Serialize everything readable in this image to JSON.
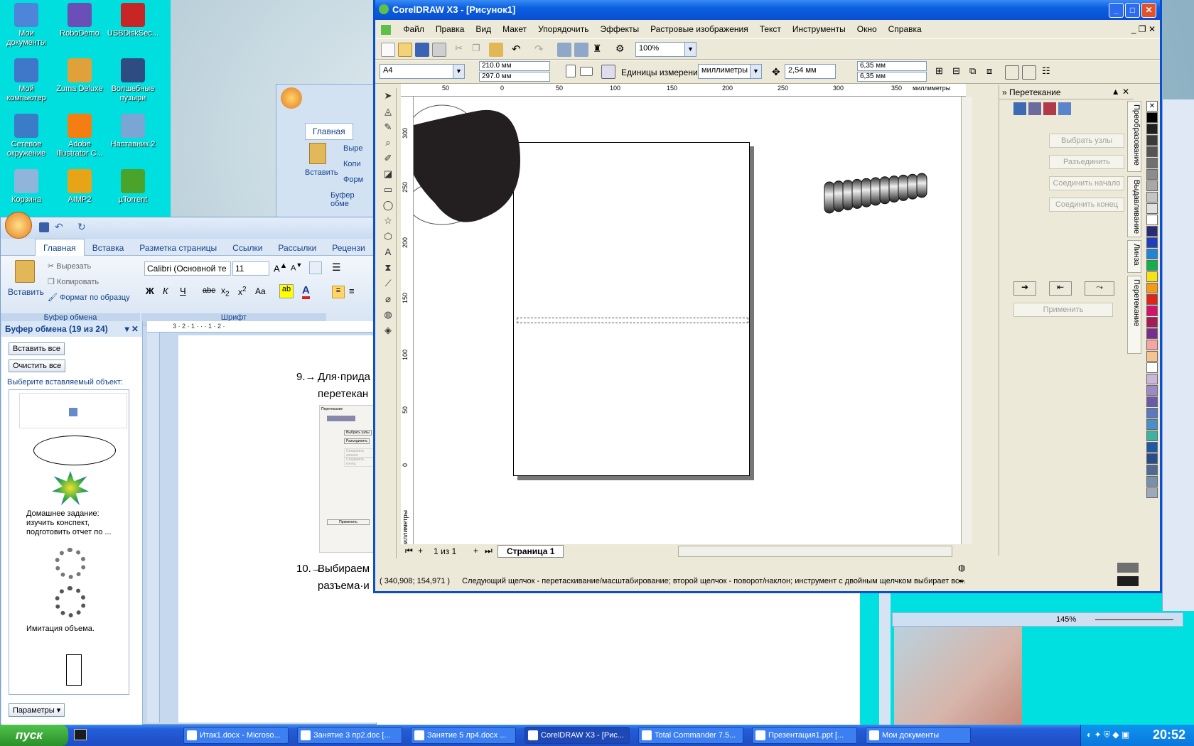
{
  "desktop": {
    "icons": [
      {
        "label": "Мои документы",
        "color": "#4d86d9"
      },
      {
        "label": "RoboDemo",
        "color": "#6a4fb6"
      },
      {
        "label": "USBDiskSec...",
        "color": "#c82626"
      },
      {
        "label": "Мой компьютер",
        "color": "#3f78c9"
      },
      {
        "label": "Zuma Deluxe",
        "color": "#e0a13b"
      },
      {
        "label": "Волшебные пузыри",
        "color": "#2f4c80"
      },
      {
        "label": "Сетевое окружение",
        "color": "#3b7cc7"
      },
      {
        "label": "Adobe Illustrator C...",
        "color": "#f57e12"
      },
      {
        "label": "Наставник 2",
        "color": "#7aa6d4"
      },
      {
        "label": "Корзина",
        "color": "#8fb6da"
      },
      {
        "label": "AIMP2",
        "color": "#e8a417"
      },
      {
        "label": "µTorrent",
        "color": "#4aa32b"
      }
    ]
  },
  "word": {
    "tabs": [
      "Главная",
      "Вставка",
      "Разметка страницы",
      "Ссылки",
      "Рассылки",
      "Рецензи"
    ],
    "active_tab": "Главная",
    "back_tab": "Главная",
    "clipboard_group": {
      "paste": "Вставить",
      "cut": "Вырезать",
      "copy": "Копировать",
      "format": "Формат по образцу",
      "label": "Буфер обмена"
    },
    "back_clipboard": {
      "cut": "Выре",
      "copy": "Копи",
      "format": "Форм",
      "label": "Буфер обме"
    },
    "font_group": {
      "font_name": "Calibri (Основной те",
      "font_size": "11",
      "label": "Шрифт",
      "bold": "Ж",
      "italic": "К",
      "underline": "Ч",
      "strike": "abe",
      "case": "Aa"
    },
    "clip_pane": {
      "title": "Буфер обмена (19 из 24)",
      "paste_all": "Вставить все",
      "clear_all": "Очистить все",
      "prompt": "Выберите вставляемый объект:",
      "text_item_1": "Домашнее задание: изучить конспект, подготовить отчет по ...",
      "text_item_2": "Имитация объема.",
      "params": "Параметры"
    },
    "document": {
      "para9_num": "9.",
      "para9_line1": "Для·прида",
      "para9_line2": "перетекан",
      "para10_num": "10.",
      "para10_line1": "Выбираем",
      "para10_line2": "разъема·и"
    },
    "zoom": "145%",
    "embedded_docker": {
      "title": "Перетекание",
      "btn1": "Выбрать узлы",
      "btn2": "Разъединить",
      "btn3": "Соединить начало",
      "btn4": "Соединить конец",
      "apply": "Применить"
    }
  },
  "corel": {
    "title": "CorelDRAW X3 - [Рисунок1]",
    "menu": [
      "Файл",
      "Правка",
      "Вид",
      "Макет",
      "Упорядочить",
      "Эффекты",
      "Растровые изображения",
      "Текст",
      "Инструменты",
      "Окно",
      "Справка"
    ],
    "zoom": "100%",
    "paper": "A4",
    "width": "210.0 мм",
    "height": "297.0 мм",
    "units_label": "Единицы измерения:",
    "units": "миллиметры",
    "nudge": "2,54 мм",
    "dup_x": "6,35 мм",
    "dup_y": "6,35 мм",
    "ruler_top_ticks": [
      "50",
      "0",
      "50",
      "100",
      "150",
      "200",
      "250",
      "300",
      "350"
    ],
    "ruler_unit": "миллиметры",
    "ruler_left_ticks": [
      "300",
      "250",
      "200",
      "150",
      "100",
      "50",
      "0"
    ],
    "page_count": "1 из 1",
    "page_tab": "Страница 1",
    "status_coords": "( 340,908; 154,971 )",
    "status_text": "Следующий щелчок - перетаскивание/масштабирование; второй щелчок - поворот/наклон; инструмент с двойным щелчком выбирает вс...",
    "docker": {
      "title": "Перетекание",
      "btn_select_nodes": "Выбрать узлы",
      "btn_split": "Разъединить",
      "btn_fuse_start": "Соединить начало",
      "btn_fuse_end": "Соединить конец",
      "btn_apply": "Применить",
      "vtabs": [
        "Преобразование",
        "Выдавливание",
        "Линза",
        "Перетекание"
      ]
    },
    "palette": [
      "#ffffff",
      "#000000",
      "#1f1f1f",
      "#3a3a3a",
      "#555555",
      "#707070",
      "#8c8c8c",
      "#a8a8a8",
      "#c4c4c4",
      "#e0e0e0",
      "#ffffff",
      "#2a2a7a",
      "#1f3fbf",
      "#1d86d6",
      "#11b04a",
      "#f7e217",
      "#f29b1a",
      "#e2231a",
      "#d6116d",
      "#a51b57",
      "#7b2d8f",
      "#f7a4a4",
      "#f6c58f",
      "#ffffff",
      "#c9b6d8",
      "#9d89c4",
      "#6b5aa8",
      "#5a7ac0",
      "#4a90c8",
      "#3bb2a4",
      "#1e5aa3",
      "#2a4c8a",
      "#506a94",
      "#7990aa",
      "#9aaab9"
    ]
  },
  "taskbar": {
    "start": "пуск",
    "tasks": [
      "Итак1.docx - Microso...",
      "Занятие 3 пр2.doc [...",
      "Занятие 5 лр4.docx ...",
      "CorelDRAW X3 - [Рис...",
      "Total Commander 7.5...",
      "Презентация1.ppt [...",
      "Мои документы"
    ],
    "active_task": 3,
    "clock": "20:52"
  }
}
